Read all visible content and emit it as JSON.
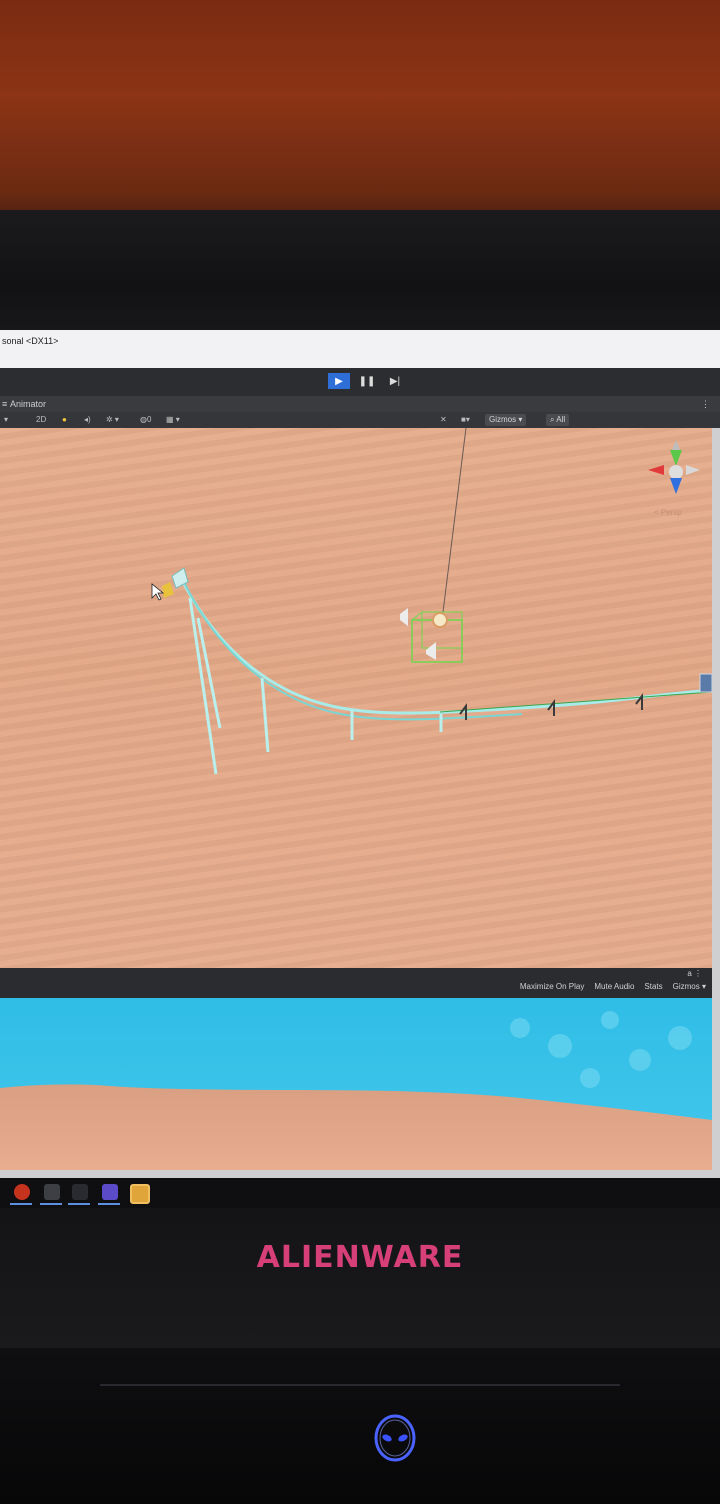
{
  "window": {
    "title": "sonal <DX11>"
  },
  "toolbar": {
    "play_icon": "play-icon",
    "pause_icon": "pause-icon",
    "step_icon": "step-icon"
  },
  "animator_tab": {
    "label": "Animator"
  },
  "scene_toolbar": {
    "mode_2d": "2D",
    "gizmos_label": "Gizmos",
    "search_label": "All"
  },
  "scene_view": {
    "persp_label": "< Persp"
  },
  "game_view": {
    "options": [
      "Maximize On Play",
      "Mute Audio",
      "Stats",
      "Gizmos"
    ]
  },
  "brand": {
    "name": "ALIENWARE"
  },
  "colors": {
    "sand": "#e3a887",
    "sky": "#33c1e8",
    "brand": "#d63f78",
    "play_active": "#2d6fd6",
    "track": "#9fe8e6"
  }
}
